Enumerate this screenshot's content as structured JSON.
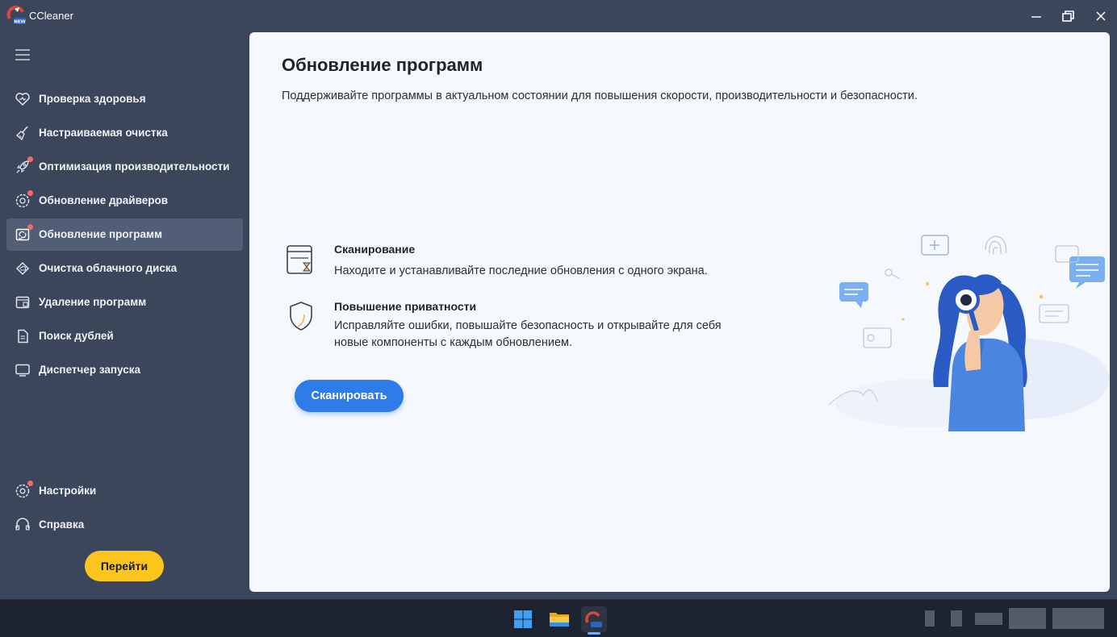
{
  "window": {
    "title": "CCleaner",
    "logo_badge": "NEW"
  },
  "sidebar": {
    "items": [
      {
        "label": "Проверка здоровья",
        "icon": "heart-icon",
        "badge": false,
        "active": false
      },
      {
        "label": "Настраиваемая очистка",
        "icon": "broom-icon",
        "badge": false,
        "active": false
      },
      {
        "label": "Оптимизация производительности",
        "icon": "rocket-icon",
        "badge": true,
        "active": false
      },
      {
        "label": "Обновление драйверов",
        "icon": "gear-refresh-icon",
        "badge": true,
        "active": false
      },
      {
        "label": "Обновление программ",
        "icon": "app-update-icon",
        "badge": true,
        "active": true
      },
      {
        "label": "Очистка облачного диска",
        "icon": "cloud-drive-icon",
        "badge": false,
        "active": false
      },
      {
        "label": "Удаление программ",
        "icon": "uninstall-icon",
        "badge": false,
        "active": false
      },
      {
        "label": "Поиск дублей",
        "icon": "duplicate-icon",
        "badge": false,
        "active": false
      },
      {
        "label": "Диспетчер запуска",
        "icon": "monitor-icon",
        "badge": false,
        "active": false
      }
    ],
    "bottom_items": [
      {
        "label": "Настройки",
        "icon": "settings-icon",
        "badge": true
      },
      {
        "label": "Справка",
        "icon": "help-icon",
        "badge": false
      }
    ],
    "go_button": "Перейти"
  },
  "main": {
    "title": "Обновление программ",
    "description": "Поддерживайте программы в актуальном состоянии для повышения скорости, производительности и безопасности.",
    "features": [
      {
        "title": "Сканирование",
        "text_lines": [
          "Находите и устанавливайте последние обновления с одного экрана."
        ],
        "icon": "scan-window-icon"
      },
      {
        "title": "Повышение приватности",
        "text_lines": [
          "Исправляйте ошибки, повышайте безопасность и открывайте для себя",
          "новые компоненты с каждым обновлением."
        ],
        "icon": "shield-icon"
      }
    ],
    "scan_button": "Сканировать"
  },
  "colors": {
    "sidebar_bg": "#3c465a",
    "active_item": "#525e76",
    "badge": "#f06c6c",
    "go_button": "#fbc51d",
    "scan_button": "#2f7be8",
    "panel_bg": "#f5f8fc"
  },
  "taskbar": {
    "icons": [
      "windows-start-icon",
      "file-explorer-icon",
      "ccleaner-taskbar-icon"
    ]
  }
}
